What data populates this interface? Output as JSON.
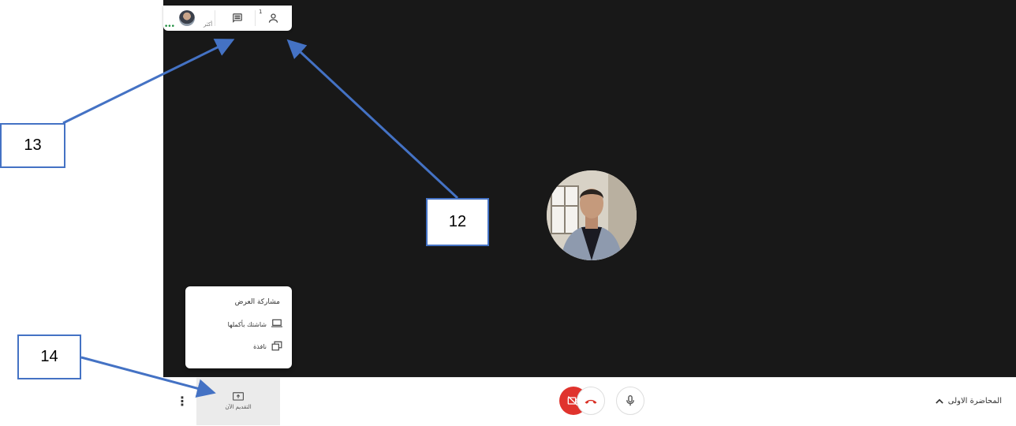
{
  "top_bar": {
    "more_label": "أكثر",
    "people_count": "1",
    "icons": [
      "user-avatar",
      "chat-icon",
      "people-icon"
    ]
  },
  "share_menu": {
    "title": "مشاركة العرض",
    "items": [
      {
        "label": "شاشتك بأكملها",
        "icon": "monitor-icon"
      },
      {
        "label": "نافذة",
        "icon": "window-icon"
      }
    ]
  },
  "bottom_bar": {
    "present_label": "التقديم الآن",
    "meeting_title": "المحاضرة الاولى",
    "controls": [
      "camera-off-icon",
      "hang-up-icon",
      "microphone-icon"
    ]
  },
  "callouts": {
    "c12": "12",
    "c13": "13",
    "c14": "14"
  },
  "colors": {
    "stage_bg": "#181818",
    "camera_off_red": "#e0332d",
    "hangup_red": "#d93025",
    "annotation_blue": "#4472c4",
    "status_green": "#1e8e3e"
  }
}
